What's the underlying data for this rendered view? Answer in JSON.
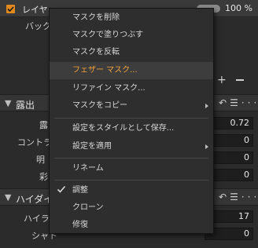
{
  "layer": {
    "name": "レイヤー",
    "opacity": "100 %",
    "background_label": "バックグ"
  },
  "sections": {
    "exposure": {
      "title": "露出"
    },
    "hdr": {
      "title": "ハイダイ"
    }
  },
  "exposure_params": [
    {
      "label": "露",
      "value": "0.72"
    },
    {
      "label": "コントラス",
      "value": "0"
    },
    {
      "label": "明",
      "value": "0"
    },
    {
      "label": "彩",
      "value": "0"
    }
  ],
  "hdr_params": [
    {
      "label": "ハイライ",
      "value": "17"
    },
    {
      "label": "シャト",
      "value": "0"
    }
  ],
  "menu": {
    "items": [
      {
        "label": "マスクを削除"
      },
      {
        "label": "マスクで塗りつぶす"
      },
      {
        "label": "マスクを反転"
      },
      {
        "label": "フェザー マスク..."
      },
      {
        "label": "リファイン マスク..."
      },
      {
        "label": "マスクをコピー"
      },
      {
        "label": "設定をスタイルとして保存..."
      },
      {
        "label": "設定を適用"
      },
      {
        "label": "リネーム"
      },
      {
        "label": "調整"
      },
      {
        "label": "クローン"
      },
      {
        "label": "修復"
      }
    ]
  },
  "colors": {
    "accent": "#e08a1e",
    "highlight_text": "#f0a23c"
  }
}
